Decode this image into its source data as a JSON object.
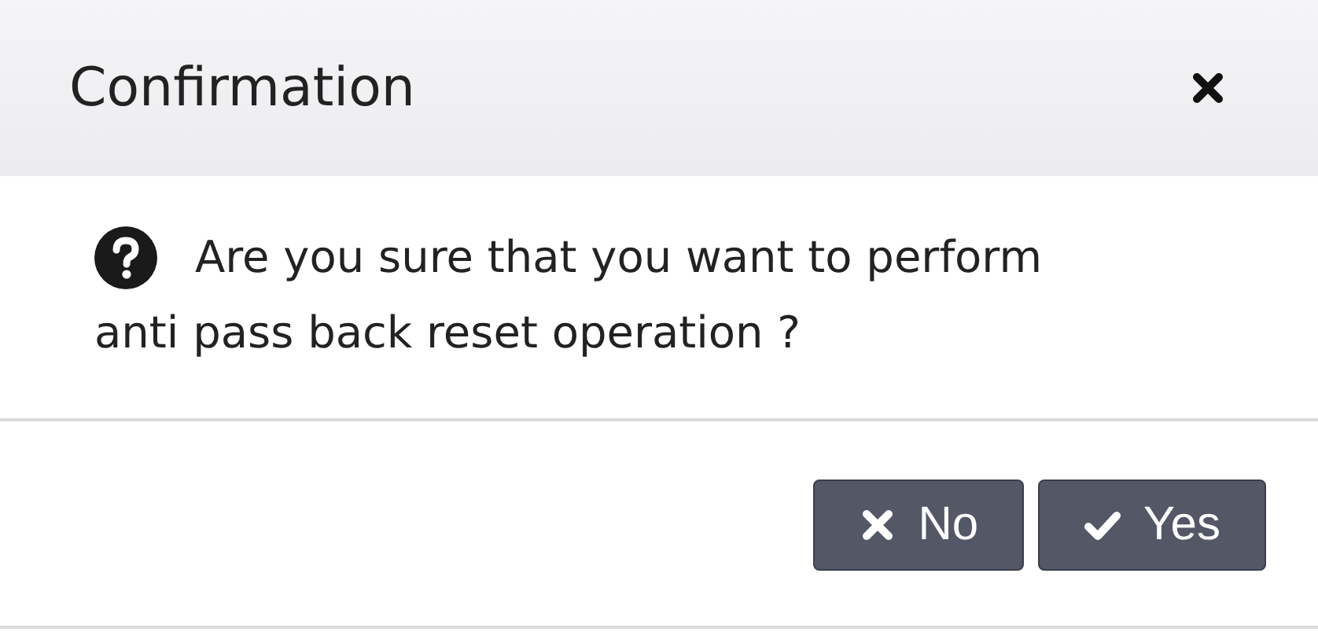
{
  "dialog": {
    "title": "Confirmation",
    "message_lines": [
      "Are you sure that you want to perform",
      "anti pass back reset operation ?"
    ],
    "buttons": [
      {
        "kind": "cancel",
        "label": "No"
      },
      {
        "kind": "confirm",
        "label": "Yes"
      }
    ]
  }
}
